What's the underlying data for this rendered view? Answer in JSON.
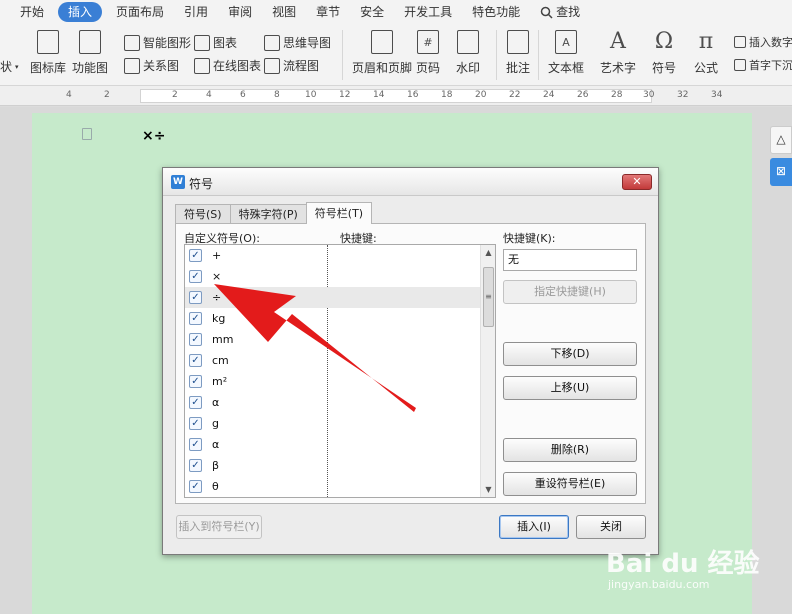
{
  "menu": {
    "items": [
      "开始",
      "插入",
      "页面布局",
      "引用",
      "审阅",
      "视图",
      "章节",
      "安全",
      "开发工具",
      "特色功能"
    ],
    "active_index": 1,
    "search": "查找"
  },
  "ribbon": {
    "small": {
      "shape_partial": "状",
      "smart_graphic": "智能图形",
      "chart": "图表",
      "mind_map": "思维导图",
      "relation": "关系图",
      "online_chart": "在线图表",
      "flowchart": "流程图",
      "insert_number": "插入数字",
      "drop_cap": "首字下沉"
    },
    "big": {
      "icon_lib": "图标库",
      "func_chart": "功能图",
      "header_footer": "页眉和页脚",
      "page_number": "页码",
      "watermark": "水印",
      "comment": "批注",
      "text_box": "文本框",
      "word_art": "艺术字",
      "symbol": "符号",
      "formula": "公式"
    },
    "glyphs": {
      "page_number": "#",
      "text_box": "A",
      "word_art": "A",
      "symbol": "Ω",
      "formula": "π"
    }
  },
  "ruler": {
    "ticks": [
      "4",
      "2",
      "2",
      "4",
      "6",
      "8",
      "10",
      "12",
      "14",
      "16",
      "18",
      "20",
      "22",
      "24",
      "26",
      "28",
      "30",
      "32",
      "34"
    ]
  },
  "document": {
    "symbols": "×÷"
  },
  "dialog": {
    "title": "符号",
    "logo": "W",
    "close": "✕",
    "tabs": [
      "符号(S)",
      "特殊字符(P)",
      "符号栏(T)"
    ],
    "active_tab": 2,
    "custom_symbols_label": "自定义符号(O):",
    "shortcut_col_label": "快捷键:",
    "shortcut_label": "快捷键(K):",
    "shortcut_value": "无",
    "check_mark": "✓",
    "symbols": [
      "+",
      "×",
      "÷",
      "kg",
      "mm",
      "cm",
      "m²",
      "α",
      "g",
      "α",
      "β",
      "θ"
    ],
    "selected_index": 2,
    "scroll_up": "▲",
    "scroll_down": "▼",
    "scroll_thumb": "≡",
    "buttons": {
      "assign_shortcut": "指定快捷键(H)",
      "move_down": "下移(D)",
      "move_up": "上移(U)",
      "delete": "删除(R)",
      "reset": "重设符号栏(E)",
      "insert_to_bar": "插入到符号栏(Y)",
      "insert": "插入(I)",
      "close": "关闭"
    }
  },
  "watermark": {
    "brand": "Bai du 经验",
    "url": "jingyan.baidu.com"
  },
  "colors": {
    "accent": "#3a7fd5",
    "page": "#c6eacb",
    "arrow": "#e31b1b"
  }
}
